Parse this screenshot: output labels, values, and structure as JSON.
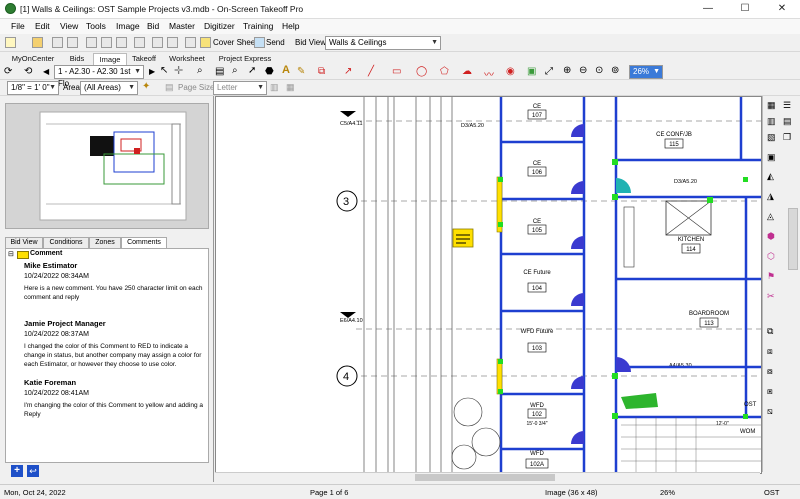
{
  "window": {
    "title": "[1] Walls & Ceilings: OST Sample Projects v3.mdb - On-Screen Takeoff Pro",
    "minimize": "—",
    "maximize": "☐",
    "close": "✕"
  },
  "menu": [
    "File",
    "Edit",
    "View",
    "Tools",
    "Image",
    "Bid",
    "Master",
    "Digitizer",
    "Training",
    "Help"
  ],
  "toolbar": {
    "cover_sheet": "Cover Sheet",
    "send": "Send",
    "bid_view_label": "Bid View",
    "bid_view_value": "Walls & Ceilings"
  },
  "tabs": [
    "MyOnCenter",
    "Bids",
    "Image",
    "Takeoff",
    "Worksheet",
    "Project Express"
  ],
  "page_select": "1 - A2.30 - A2.30 1st Flo",
  "zoom": "26%",
  "scale": "1/8\" = 1' 0\"",
  "area_label": "Area",
  "area_value": "(All Areas)",
  "page_size_label": "Page Size",
  "page_size_value": "Letter",
  "panel_tabs": [
    "Bid View",
    "Conditions",
    "Zones",
    "Comments"
  ],
  "comments": {
    "header": "Comment",
    "items": [
      {
        "name": "Mike Estimator",
        "date": "10/24/2022 08:34AM",
        "text": "Here is a new comment. You have 250 character limit on each comment and reply"
      },
      {
        "name": "Jamie Project Manager",
        "date": "10/24/2022 08:37AM",
        "text": "I changed the color of this Comment to RED to indicate a change in status, but another company may assign a color for each Estimator, or however they choose to use color."
      },
      {
        "name": "Katie Foreman",
        "date": "10/24/2022 08:41AM",
        "text": "I'm changing the color of this Comment to yellow and adding a Reply"
      }
    ]
  },
  "rooms": [
    {
      "name": "CE",
      "num": "107"
    },
    {
      "name": "CE",
      "num": "106"
    },
    {
      "name": "CE",
      "num": "105"
    },
    {
      "name": "CE Future",
      "num": "104"
    },
    {
      "name": "WFD Future",
      "num": "103"
    },
    {
      "name": "WFD",
      "num": "102"
    },
    {
      "name": "WFD",
      "num": "102A"
    },
    {
      "name": "CE CONF/JB",
      "num": "115"
    },
    {
      "name": "KITCHEN",
      "num": "114"
    },
    {
      "name": "BOARDROOM",
      "num": "113"
    }
  ],
  "drawing_labels": {
    "grid3": "3",
    "grid4": "4",
    "sec1": "C5/A4.11",
    "sec2": "D3/A5.20",
    "sec3": "E6/A4.10",
    "sec4": "A4/A5.30",
    "sec5": "D3/A5.20",
    "dim": "15'-0 3/4\"",
    "wom": "WOM",
    "dim2": "12'-0\"",
    "ost": "OST"
  },
  "status": {
    "date": "Mon, Oct 24, 2022",
    "page": "Page 1 of 6",
    "image": "Image (36 x 48)",
    "zoom": "26%",
    "app": "OST"
  },
  "colors": {
    "wall_blue": "#1e3fd0",
    "door_blue": "#3a3ad0",
    "highlight_yellow": "#ffe000",
    "green_marker": "#22dd22"
  }
}
